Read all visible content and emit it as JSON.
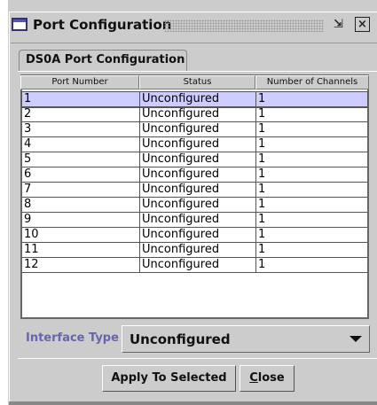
{
  "window": {
    "title": "Port Configuration",
    "restore_glyph": "⇲",
    "close_glyph": "⊠"
  },
  "tab": {
    "label": "DS0A Port Configuration"
  },
  "table": {
    "columns": [
      "Port Number",
      "Status",
      "Number of Channels"
    ],
    "rows": [
      {
        "port": "1",
        "status": "Unconfigured",
        "channels": "1"
      },
      {
        "port": "2",
        "status": "Unconfigured",
        "channels": "1"
      },
      {
        "port": "3",
        "status": "Unconfigured",
        "channels": "1"
      },
      {
        "port": "4",
        "status": "Unconfigured",
        "channels": "1"
      },
      {
        "port": "5",
        "status": "Unconfigured",
        "channels": "1"
      },
      {
        "port": "6",
        "status": "Unconfigured",
        "channels": "1"
      },
      {
        "port": "7",
        "status": "Unconfigured",
        "channels": "1"
      },
      {
        "port": "8",
        "status": "Unconfigured",
        "channels": "1"
      },
      {
        "port": "9",
        "status": "Unconfigured",
        "channels": "1"
      },
      {
        "port": "10",
        "status": "Unconfigured",
        "channels": "1"
      },
      {
        "port": "11",
        "status": "Unconfigured",
        "channels": "1"
      },
      {
        "port": "12",
        "status": "Unconfigured",
        "channels": "1"
      }
    ],
    "selected_row": 0
  },
  "interface": {
    "label": "Interface Type",
    "value": "Unconfigured"
  },
  "buttons": {
    "apply": "Apply To Selected",
    "close": "Close"
  },
  "colors": {
    "background": "#cccccc",
    "selection": "#ccccff",
    "label_accent": "#6666aa"
  },
  "icons": [
    "window-icon",
    "restore-icon",
    "close-icon",
    "dropdown-arrow-icon"
  ]
}
